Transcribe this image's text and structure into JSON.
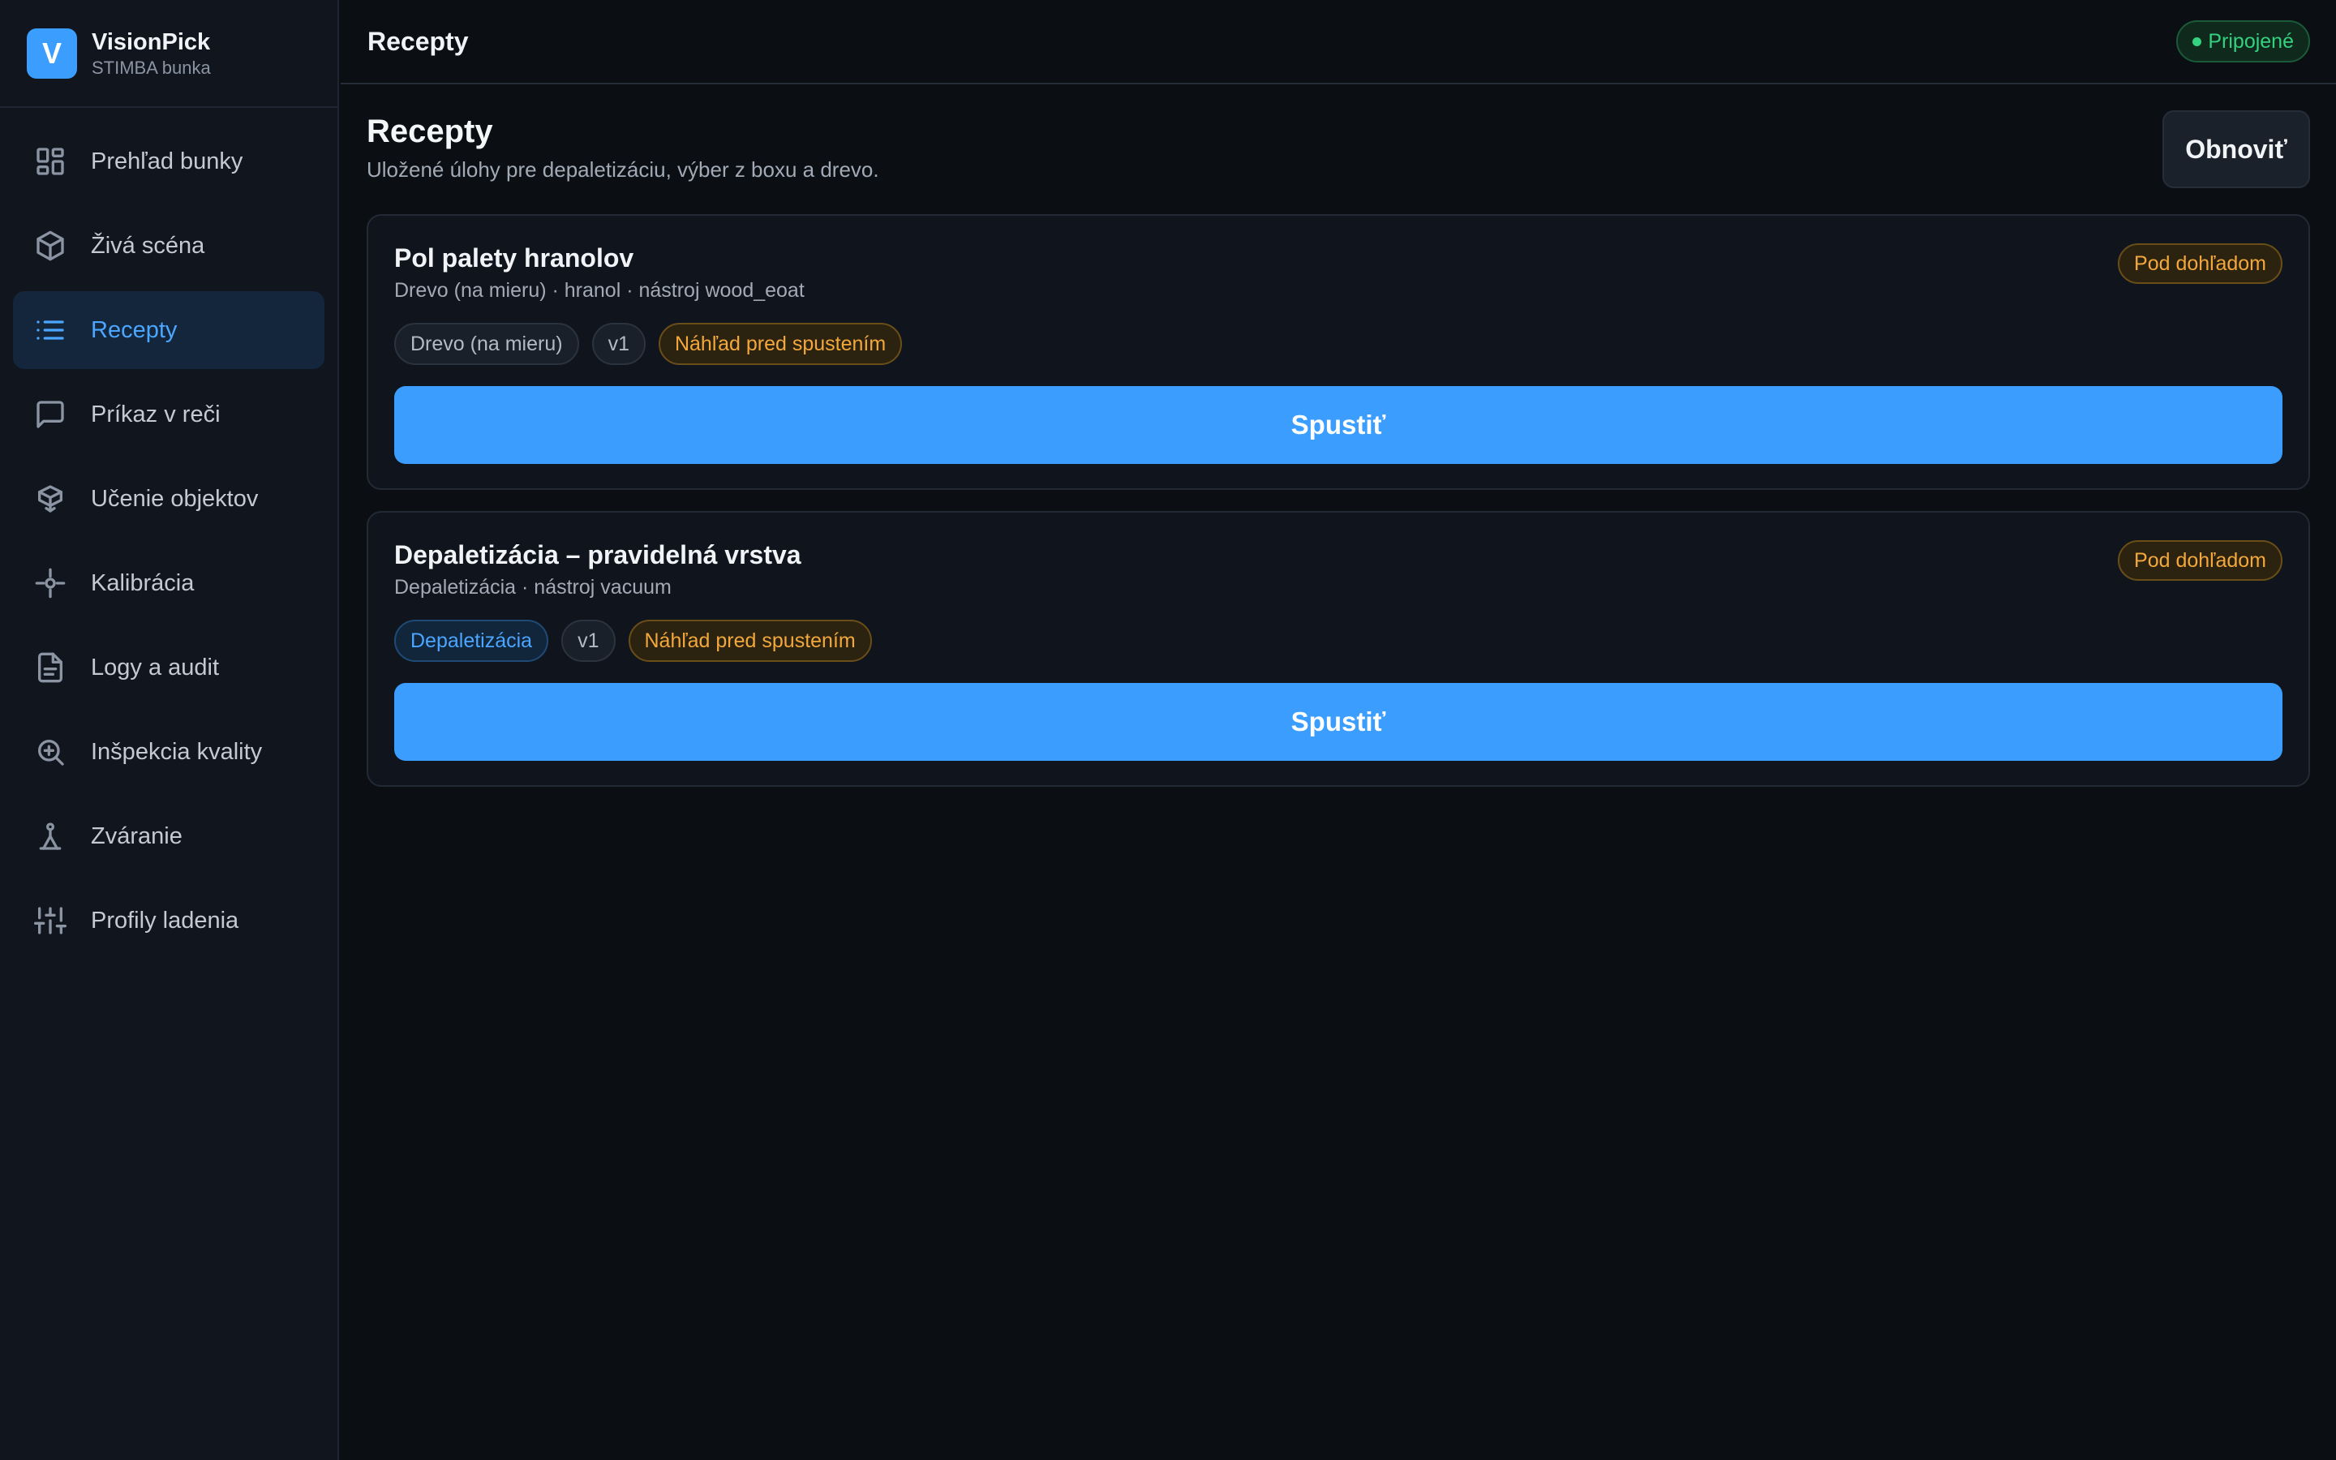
{
  "brand": {
    "logo_letter": "V",
    "name": "VisionPick",
    "subtitle": "STIMBA bunka"
  },
  "sidebar": {
    "items": [
      {
        "label": "Prehľad bunky",
        "icon": "dashboard-icon",
        "active": false
      },
      {
        "label": "Živá scéna",
        "icon": "cube-icon",
        "active": false
      },
      {
        "label": "Recepty",
        "icon": "list-icon",
        "active": true
      },
      {
        "label": "Príkaz v reči",
        "icon": "chat-icon",
        "active": false
      },
      {
        "label": "Učenie objektov",
        "icon": "box-learn-icon",
        "active": false
      },
      {
        "label": "Kalibrácia",
        "icon": "crosshair-icon",
        "active": false
      },
      {
        "label": "Logy a audit",
        "icon": "document-icon",
        "active": false
      },
      {
        "label": "Inšpekcia kvality",
        "icon": "zoom-in-icon",
        "active": false
      },
      {
        "label": "Zváranie",
        "icon": "welding-icon",
        "active": false
      },
      {
        "label": "Profily ladenia",
        "icon": "sliders-icon",
        "active": false
      }
    ]
  },
  "topbar": {
    "title": "Recepty",
    "status": "Pripojené",
    "status_color": "#34d17f"
  },
  "page": {
    "title": "Recepty",
    "subtitle": "Uložené úlohy pre depaletizáciu, výber z boxu a drevo.",
    "refresh_label": "Obnoviť"
  },
  "recipes": [
    {
      "title": "Pol palety hranolov",
      "meta": "Drevo (na mieru) · hranol · nástroj wood_eoat",
      "badge": "Pod dohľadom",
      "tags": [
        {
          "label": "Drevo (na mieru)",
          "kind": "neutral"
        },
        {
          "label": "v1",
          "kind": "neutral"
        },
        {
          "label": "Náhľad pred spustením",
          "kind": "warn"
        }
      ],
      "run_label": "Spustiť"
    },
    {
      "title": "Depaletizácia – pravidelná vrstva",
      "meta": "Depaletizácia · nástroj vacuum",
      "badge": "Pod dohľadom",
      "tags": [
        {
          "label": "Depaletizácia",
          "kind": "blue"
        },
        {
          "label": "v1",
          "kind": "neutral"
        },
        {
          "label": "Náhľad pred spustením",
          "kind": "warn"
        }
      ],
      "run_label": "Spustiť"
    }
  ],
  "colors": {
    "accent": "#3b9eff",
    "warning": "#f3a83b",
    "background": "#0b0e13",
    "sidebar": "#11161e"
  }
}
